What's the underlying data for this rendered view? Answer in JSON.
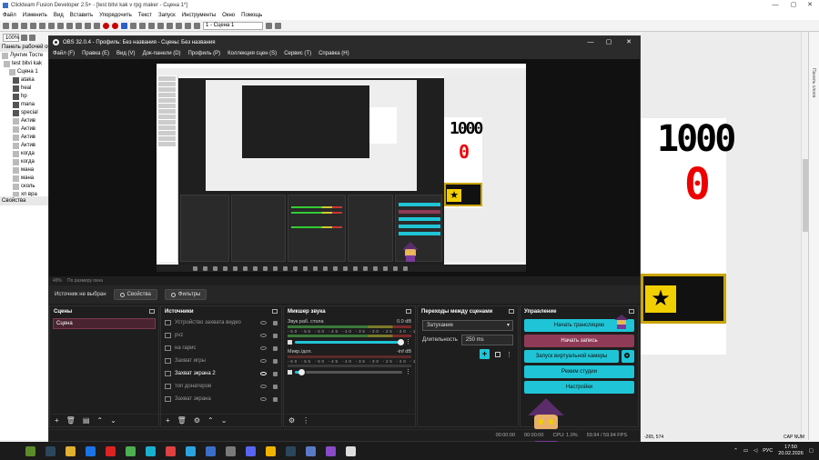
{
  "background_app": {
    "title": "Clickteam Fusion Developer 2.5+ - [test bitvi kak v rpg maker - Сцена 1*]",
    "menu": [
      "Файл",
      "Изменить",
      "Вид",
      "Вставить",
      "Упорядочить",
      "Текст",
      "Запуск",
      "Инструменты",
      "Окно",
      "Помощь"
    ],
    "zoom": "100%",
    "frame_combo": "1 - Сцена 1",
    "workspace_title": "Панель рабочей обл",
    "tree": [
      {
        "label": "Лунтик Тосте",
        "dark": false
      },
      {
        "label": "test bitvi kak",
        "dark": false
      },
      {
        "label": "Сцена 1",
        "dark": false
      },
      {
        "label": "ataka",
        "dark": true
      },
      {
        "label": "heal",
        "dark": true
      },
      {
        "label": "hp",
        "dark": true
      },
      {
        "label": "mana",
        "dark": true
      },
      {
        "label": "special",
        "dark": true
      },
      {
        "label": "Актив",
        "dark": false
      },
      {
        "label": "Актив",
        "dark": false
      },
      {
        "label": "Актив",
        "dark": false
      },
      {
        "label": "Актив",
        "dark": false
      },
      {
        "label": "когда",
        "dark": false
      },
      {
        "label": "когда",
        "dark": false
      },
      {
        "label": "мана",
        "dark": false
      },
      {
        "label": "мана",
        "dark": false
      },
      {
        "label": "сколь",
        "dark": false
      },
      {
        "label": "хп вра",
        "dark": false
      }
    ],
    "properties_title": "Свойства",
    "canvas_number": "1000",
    "canvas_zero": "0",
    "right_side_label": "Панель слоев",
    "coords": "-265, 574",
    "cap": "CAP NUM"
  },
  "obs": {
    "title": "OBS 32.0.4 - Профиль: Без названия - Сцены: Без названия",
    "menu": [
      "Файл (F)",
      "Правка (E)",
      "Вид (V)",
      "Док-панели (D)",
      "Профиль (P)",
      "Коллекция сцен (S)",
      "Сервис (T)",
      "Справка (H)"
    ],
    "preview_bar": {
      "zoom": "49%",
      "fit": "По размеру окна"
    },
    "source_bar": {
      "status": "Источник не выбран",
      "properties": "Свойства",
      "filters": "Фильтры"
    },
    "scenes": {
      "title": "Сцены",
      "items": [
        "Сцена"
      ]
    },
    "sources": {
      "title": "Источники",
      "items": [
        {
          "label": "Устройство захвата видео",
          "on": false
        },
        {
          "label": "pvz",
          "on": false
        },
        {
          "label": "на гарис",
          "on": false
        },
        {
          "label": "Захват игры",
          "on": false
        },
        {
          "label": "Захват экрана 2",
          "on": true
        },
        {
          "label": "топ донатеров",
          "on": false
        },
        {
          "label": "Захват экрана",
          "on": false
        }
      ]
    },
    "mixer": {
      "title": "Микшер звука",
      "channels": [
        {
          "name": "Звук раб. стола",
          "db": "0.0 dB",
          "volume": 1.0
        },
        {
          "name": "Микр./доп.",
          "db": "-inf dB",
          "volume": 0.15
        }
      ],
      "ticks": "-60 -55 -50 -45 -40 -35 -30 -25 -20 -15 -10 -5 0"
    },
    "transitions": {
      "title": "Переходы между сценами",
      "selected": "Затухание",
      "duration_label": "Длительность",
      "duration_value": "250 ms"
    },
    "controls": {
      "title": "Управление",
      "start_stream": "Начать трансляцию",
      "start_record": "Начать запись",
      "virtual_cam": "Запуск виртуальной камеры",
      "studio_mode": "Режим студии",
      "settings": "Настройки"
    },
    "status": {
      "stream_time": "00:00:00",
      "rec_time": "00:00:00",
      "cpu": "CPU: 1.0%",
      "fps": "59.94 / 59.94 FPS"
    },
    "nested": {
      "number": "1000",
      "zero": "0"
    }
  },
  "taskbar": {
    "apps": [
      {
        "name": "minecraft-icon",
        "color": "#5b8c2a"
      },
      {
        "name": "steam-icon",
        "color": "#2a475e"
      },
      {
        "name": "folder-icon",
        "color": "#e0b030"
      },
      {
        "name": "browser-icon",
        "color": "#1a73e8"
      },
      {
        "name": "yandex-icon",
        "color": "#d22"
      },
      {
        "name": "chrome-icon",
        "color": "#4caf50"
      },
      {
        "name": "shield-icon",
        "color": "#1ab0d0"
      },
      {
        "name": "microphone-icon",
        "color": "#e04040"
      },
      {
        "name": "telegram-icon",
        "color": "#2aa3e0"
      },
      {
        "name": "fusion-icon",
        "color": "#3a6fc9"
      },
      {
        "name": "store-icon",
        "color": "#7a7a7a"
      },
      {
        "name": "discord-icon",
        "color": "#5865f2"
      },
      {
        "name": "chart-icon",
        "color": "#f0b400"
      },
      {
        "name": "steam-icon",
        "color": "#2a475e"
      },
      {
        "name": "game-icon",
        "color": "#5a7ac9"
      },
      {
        "name": "app-icon",
        "color": "#8a4ac9"
      },
      {
        "name": "obs-icon",
        "color": "#ddd"
      }
    ],
    "lang": "РУС",
    "time": "17:50",
    "date": "20.02.2026"
  }
}
